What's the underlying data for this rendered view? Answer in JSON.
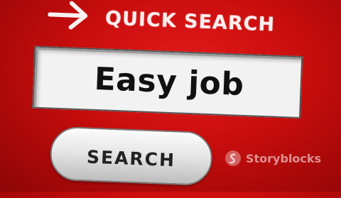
{
  "header": {
    "title": "QUICK SEARCH",
    "arrow_icon": "arrow-right-icon"
  },
  "search": {
    "value": "Easy job",
    "button_label": "SEARCH"
  },
  "watermark": {
    "text": "Storyblocks",
    "icon": "storyblocks-logo-icon"
  },
  "colors": {
    "background": "#d01010",
    "heading": "#fdeeee",
    "field_bg": "#f2f2f2"
  }
}
